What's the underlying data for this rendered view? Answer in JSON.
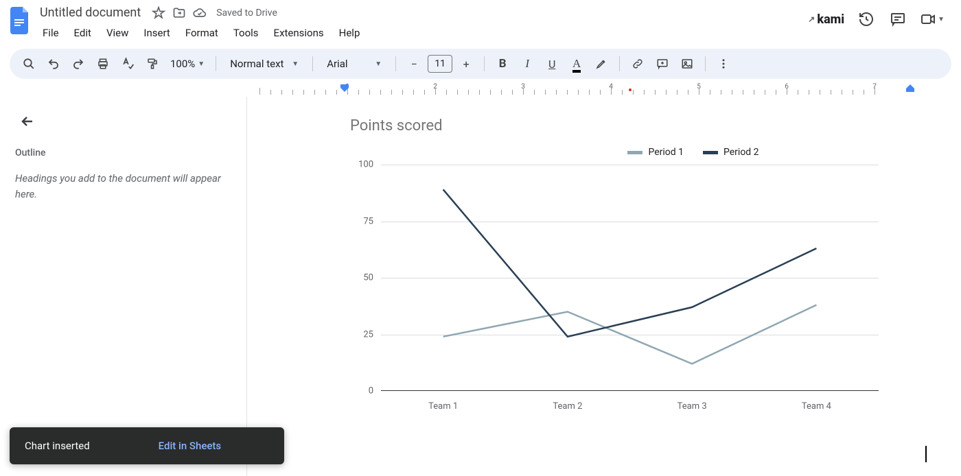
{
  "title": "Untitled document",
  "save_status": "Saved to Drive",
  "kami_label": "kami",
  "menu": [
    "File",
    "Edit",
    "View",
    "Insert",
    "Format",
    "Tools",
    "Extensions",
    "Help"
  ],
  "toolbar": {
    "zoom": "100%",
    "style": "Normal text",
    "font": "Arial",
    "font_size": "11"
  },
  "sidebar": {
    "outline_label": "Outline",
    "outline_hint": "Headings you add to the document will appear here."
  },
  "toast": {
    "message": "Chart inserted",
    "action": "Edit in Sheets"
  },
  "chart_data": {
    "type": "line",
    "title": "Points scored",
    "categories": [
      "Team 1",
      "Team 2",
      "Team 3",
      "Team 4"
    ],
    "series": [
      {
        "name": "Period 1",
        "color": "#8fa7b3",
        "values": [
          24,
          35,
          12,
          38
        ]
      },
      {
        "name": "Period 2",
        "color": "#2a3f54",
        "values": [
          89,
          24,
          37,
          63
        ]
      }
    ],
    "y_ticks": [
      0,
      25,
      50,
      75,
      100
    ],
    "ylim": [
      0,
      100
    ]
  }
}
